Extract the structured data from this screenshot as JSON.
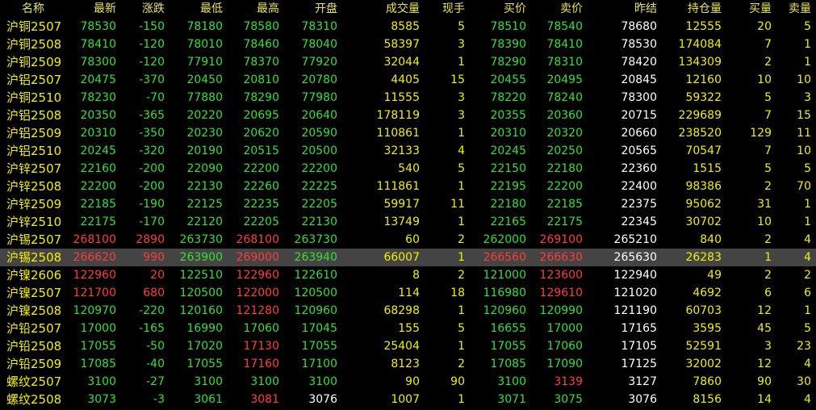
{
  "colors": {
    "header": "#e6e65c",
    "yellow": "#f0f000",
    "green": "#33e033",
    "red": "#ff3b3b",
    "white": "#ffffff",
    "selected_row": "#444444"
  },
  "columns": [
    "名称",
    "最新",
    "涨跌",
    "最低",
    "最高",
    "开盘",
    "成交量",
    "现手",
    "买价",
    "卖价",
    "昨结",
    "持仓量",
    "买量",
    "卖量"
  ],
  "rows": [
    {
      "name": "沪铜2507",
      "cells": [
        "78530",
        "-150",
        "78180",
        "78580",
        "78310",
        "8585",
        "5",
        "78510",
        "78540",
        "78680",
        "12555",
        "20",
        "5"
      ],
      "colors": [
        "green",
        "green",
        "green",
        "green",
        "green",
        "yellow",
        "yellow",
        "green",
        "green",
        "white",
        "yellow",
        "yellow",
        "yellow"
      ]
    },
    {
      "name": "沪铜2508",
      "cells": [
        "78410",
        "-120",
        "78010",
        "78460",
        "78040",
        "58397",
        "3",
        "78390",
        "78410",
        "78530",
        "174084",
        "7",
        "1"
      ],
      "colors": [
        "green",
        "green",
        "green",
        "green",
        "green",
        "yellow",
        "yellow",
        "green",
        "green",
        "white",
        "yellow",
        "yellow",
        "yellow"
      ]
    },
    {
      "name": "沪铜2509",
      "cells": [
        "78300",
        "-120",
        "77910",
        "78370",
        "77920",
        "32044",
        "1",
        "78290",
        "78310",
        "78420",
        "134309",
        "2",
        "1"
      ],
      "colors": [
        "green",
        "green",
        "green",
        "green",
        "green",
        "yellow",
        "yellow",
        "green",
        "green",
        "white",
        "yellow",
        "yellow",
        "yellow"
      ]
    },
    {
      "name": "沪铝2507",
      "cells": [
        "20475",
        "-370",
        "20450",
        "20810",
        "20780",
        "4405",
        "15",
        "20455",
        "20495",
        "20845",
        "12160",
        "10",
        "10"
      ],
      "colors": [
        "green",
        "green",
        "green",
        "green",
        "green",
        "yellow",
        "yellow",
        "green",
        "green",
        "white",
        "yellow",
        "yellow",
        "yellow"
      ]
    },
    {
      "name": "沪铜2510",
      "cells": [
        "78230",
        "-70",
        "77880",
        "78290",
        "77980",
        "11555",
        "3",
        "78220",
        "78240",
        "78300",
        "59322",
        "5",
        "3"
      ],
      "colors": [
        "green",
        "green",
        "green",
        "green",
        "green",
        "yellow",
        "yellow",
        "green",
        "green",
        "white",
        "yellow",
        "yellow",
        "yellow"
      ]
    },
    {
      "name": "沪铝2508",
      "cells": [
        "20350",
        "-365",
        "20220",
        "20695",
        "20640",
        "178119",
        "3",
        "20355",
        "20360",
        "20715",
        "229689",
        "7",
        "15"
      ],
      "colors": [
        "green",
        "green",
        "green",
        "green",
        "green",
        "yellow",
        "yellow",
        "green",
        "green",
        "white",
        "yellow",
        "yellow",
        "yellow"
      ]
    },
    {
      "name": "沪铝2509",
      "cells": [
        "20310",
        "-350",
        "20230",
        "20620",
        "20590",
        "110861",
        "1",
        "20310",
        "20320",
        "20660",
        "238520",
        "129",
        "11"
      ],
      "colors": [
        "green",
        "green",
        "green",
        "green",
        "green",
        "yellow",
        "yellow",
        "green",
        "green",
        "white",
        "yellow",
        "yellow",
        "yellow"
      ]
    },
    {
      "name": "沪铝2510",
      "cells": [
        "20245",
        "-320",
        "20190",
        "20515",
        "20500",
        "32133",
        "4",
        "20245",
        "20250",
        "20565",
        "70547",
        "7",
        "10"
      ],
      "colors": [
        "green",
        "green",
        "green",
        "green",
        "green",
        "yellow",
        "yellow",
        "green",
        "green",
        "white",
        "yellow",
        "yellow",
        "yellow"
      ]
    },
    {
      "name": "沪锌2507",
      "cells": [
        "22160",
        "-200",
        "22090",
        "22200",
        "22200",
        "540",
        "5",
        "22150",
        "22180",
        "22360",
        "1515",
        "5",
        "5"
      ],
      "colors": [
        "green",
        "green",
        "green",
        "green",
        "green",
        "yellow",
        "yellow",
        "green",
        "green",
        "white",
        "yellow",
        "yellow",
        "yellow"
      ]
    },
    {
      "name": "沪锌2508",
      "cells": [
        "22200",
        "-200",
        "22130",
        "22260",
        "22225",
        "111861",
        "1",
        "22195",
        "22200",
        "22400",
        "98386",
        "2",
        "70"
      ],
      "colors": [
        "green",
        "green",
        "green",
        "green",
        "green",
        "yellow",
        "yellow",
        "green",
        "green",
        "white",
        "yellow",
        "yellow",
        "yellow"
      ]
    },
    {
      "name": "沪锌2509",
      "cells": [
        "22185",
        "-190",
        "22125",
        "22235",
        "22205",
        "59917",
        "11",
        "22180",
        "22185",
        "22375",
        "95062",
        "31",
        "1"
      ],
      "colors": [
        "green",
        "green",
        "green",
        "green",
        "green",
        "yellow",
        "yellow",
        "green",
        "green",
        "white",
        "yellow",
        "yellow",
        "yellow"
      ]
    },
    {
      "name": "沪锌2510",
      "cells": [
        "22175",
        "-170",
        "22120",
        "22205",
        "22130",
        "13749",
        "1",
        "22165",
        "22175",
        "22345",
        "30702",
        "10",
        "1"
      ],
      "colors": [
        "green",
        "green",
        "green",
        "green",
        "green",
        "yellow",
        "yellow",
        "green",
        "green",
        "white",
        "yellow",
        "yellow",
        "yellow"
      ]
    },
    {
      "name": "沪锡2507",
      "cells": [
        "268100",
        "2890",
        "263730",
        "268100",
        "263730",
        "60",
        "2",
        "262000",
        "269100",
        "265210",
        "840",
        "2",
        "4"
      ],
      "colors": [
        "red",
        "red",
        "green",
        "red",
        "green",
        "yellow",
        "yellow",
        "green",
        "red",
        "white",
        "yellow",
        "yellow",
        "yellow"
      ]
    },
    {
      "name": "沪锡2508",
      "selected": true,
      "cells": [
        "266620",
        "990",
        "263900",
        "269000",
        "263940",
        "66007",
        "1",
        "266560",
        "266630",
        "265630",
        "26283",
        "1",
        "4"
      ],
      "colors": [
        "red",
        "red",
        "green",
        "red",
        "green",
        "yellow",
        "yellow",
        "red",
        "red",
        "white",
        "yellow",
        "yellow",
        "yellow"
      ]
    },
    {
      "name": "沪镍2606",
      "cells": [
        "122960",
        "20",
        "122510",
        "122960",
        "122610",
        "8",
        "2",
        "121000",
        "123600",
        "122940",
        "49",
        "2",
        "2"
      ],
      "colors": [
        "red",
        "red",
        "green",
        "red",
        "green",
        "yellow",
        "yellow",
        "green",
        "red",
        "white",
        "yellow",
        "yellow",
        "yellow"
      ]
    },
    {
      "name": "沪镍2507",
      "cells": [
        "121700",
        "680",
        "120500",
        "122000",
        "120500",
        "114",
        "18",
        "116980",
        "129610",
        "121020",
        "4692",
        "6",
        "6"
      ],
      "colors": [
        "red",
        "red",
        "green",
        "red",
        "green",
        "yellow",
        "yellow",
        "green",
        "red",
        "white",
        "yellow",
        "yellow",
        "yellow"
      ]
    },
    {
      "name": "沪镍2508",
      "cells": [
        "120970",
        "-220",
        "120160",
        "121280",
        "120960",
        "68298",
        "1",
        "120960",
        "120990",
        "121190",
        "60703",
        "12",
        "1"
      ],
      "colors": [
        "green",
        "green",
        "green",
        "red",
        "green",
        "yellow",
        "yellow",
        "green",
        "green",
        "white",
        "yellow",
        "yellow",
        "yellow"
      ]
    },
    {
      "name": "沪铅2507",
      "cells": [
        "17000",
        "-165",
        "16990",
        "17060",
        "17045",
        "155",
        "5",
        "16655",
        "17000",
        "17165",
        "3595",
        "45",
        "5"
      ],
      "colors": [
        "green",
        "green",
        "green",
        "green",
        "green",
        "yellow",
        "yellow",
        "green",
        "green",
        "white",
        "yellow",
        "yellow",
        "yellow"
      ]
    },
    {
      "name": "沪铅2508",
      "cells": [
        "17055",
        "-50",
        "17020",
        "17130",
        "17055",
        "25404",
        "1",
        "17055",
        "17060",
        "17105",
        "52591",
        "3",
        "23"
      ],
      "colors": [
        "green",
        "green",
        "green",
        "red",
        "green",
        "yellow",
        "yellow",
        "green",
        "green",
        "white",
        "yellow",
        "yellow",
        "yellow"
      ]
    },
    {
      "name": "沪铅2509",
      "cells": [
        "17085",
        "-40",
        "17055",
        "17160",
        "17100",
        "8123",
        "2",
        "17085",
        "17090",
        "17125",
        "32002",
        "12",
        "4"
      ],
      "colors": [
        "green",
        "green",
        "green",
        "red",
        "green",
        "yellow",
        "yellow",
        "green",
        "green",
        "white",
        "yellow",
        "yellow",
        "yellow"
      ]
    },
    {
      "name": "螺纹2507",
      "cells": [
        "3100",
        "-27",
        "3100",
        "3100",
        "3100",
        "90",
        "90",
        "3100",
        "3139",
        "3127",
        "7860",
        "90",
        "30"
      ],
      "colors": [
        "green",
        "green",
        "green",
        "green",
        "green",
        "yellow",
        "yellow",
        "green",
        "red",
        "white",
        "yellow",
        "yellow",
        "yellow"
      ]
    },
    {
      "name": "螺纹2508",
      "cells": [
        "3073",
        "-3",
        "3061",
        "3081",
        "3076",
        "1007",
        "1",
        "3071",
        "3075",
        "3076",
        "8156",
        "14",
        "4"
      ],
      "colors": [
        "green",
        "green",
        "green",
        "red",
        "white",
        "yellow",
        "yellow",
        "green",
        "green",
        "white",
        "yellow",
        "yellow",
        "yellow"
      ]
    }
  ]
}
